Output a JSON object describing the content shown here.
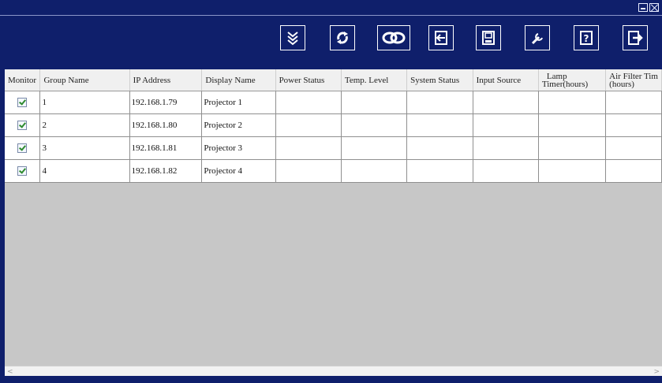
{
  "window": {
    "controls": [
      "minimize-icon",
      "close-icon"
    ]
  },
  "toolbar": {
    "buttons": [
      {
        "name": "expand-down-button",
        "icon": "double-chevron-down-icon"
      },
      {
        "name": "refresh-button",
        "icon": "refresh-icon"
      },
      {
        "name": "connect-button",
        "icon": "link-icon"
      },
      {
        "name": "import-button",
        "icon": "import-icon"
      },
      {
        "name": "save-button",
        "icon": "floppy-disk-icon"
      },
      {
        "name": "settings-button",
        "icon": "wrench-icon"
      },
      {
        "name": "help-button",
        "icon": "help-icon",
        "glyph": "?"
      },
      {
        "name": "exit-button",
        "icon": "exit-icon"
      }
    ]
  },
  "table": {
    "headers": {
      "monitor": "Monitor",
      "group": "Group Name",
      "ip": "IP Address",
      "display": "Display Name",
      "power": "Power Status",
      "temp": "Temp. Level",
      "system": "System Status",
      "input": "Input Source",
      "lamp_l1": "Lamp",
      "lamp_l2": "Timer(hours)",
      "filter_l1": "Air Filter Tim",
      "filter_l2": "(hours)"
    },
    "rows": [
      {
        "monitor": true,
        "group": "1",
        "ip": "192.168.1.79",
        "display": "Projector 1",
        "power": "",
        "temp": "",
        "system": "",
        "input": "",
        "lamp": "",
        "filter": ""
      },
      {
        "monitor": true,
        "group": "2",
        "ip": "192.168.1.80",
        "display": "Projector 2",
        "power": "",
        "temp": "",
        "system": "",
        "input": "",
        "lamp": "",
        "filter": ""
      },
      {
        "monitor": true,
        "group": "3",
        "ip": "192.168.1.81",
        "display": "Projector 3",
        "power": "",
        "temp": "",
        "system": "",
        "input": "",
        "lamp": "",
        "filter": ""
      },
      {
        "monitor": true,
        "group": "4",
        "ip": "192.168.1.82",
        "display": "Projector 4",
        "power": "",
        "temp": "",
        "system": "",
        "input": "",
        "lamp": "",
        "filter": ""
      }
    ]
  },
  "scrollbar": {
    "left_arrow": "<",
    "right_arrow": ">"
  }
}
